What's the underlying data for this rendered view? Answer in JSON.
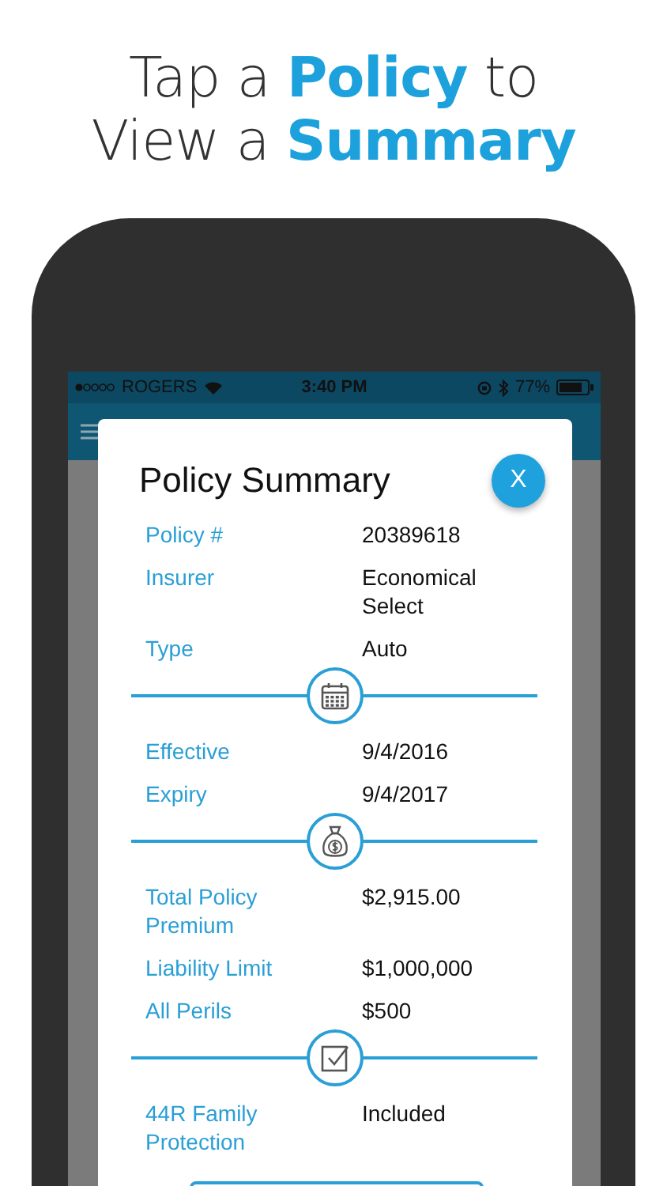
{
  "headline": [
    "Tap a **Policy** to",
    "View a **Summary**"
  ],
  "status_bar": {
    "carrier": "ROGERS",
    "time": "3:40 PM",
    "battery": "77%"
  },
  "modal": {
    "title": "Policy Summary",
    "close": "X",
    "groups": [
      {
        "rows": [
          {
            "label": "Policy #",
            "value": "20389618"
          },
          {
            "label": "Insurer",
            "value": "Economical Select"
          },
          {
            "label": "Type",
            "value": "Auto"
          }
        ]
      },
      {
        "kind": "calendar",
        "rows": [
          {
            "label": "Effective",
            "value": "9/4/2016"
          },
          {
            "label": "Expiry",
            "value": "9/4/2017"
          }
        ]
      },
      {
        "kind": "money-bag",
        "rows": [
          {
            "label": "Total Policy Premium",
            "value": "$2,915.00"
          },
          {
            "label": "Liability Limit",
            "value": "$1,000,000"
          },
          {
            "label": "All Perils",
            "value": "$500"
          }
        ]
      },
      {
        "kind": "checkbox",
        "rows": [
          {
            "label": "44R Family Protection",
            "value": "Included"
          }
        ]
      }
    ]
  }
}
